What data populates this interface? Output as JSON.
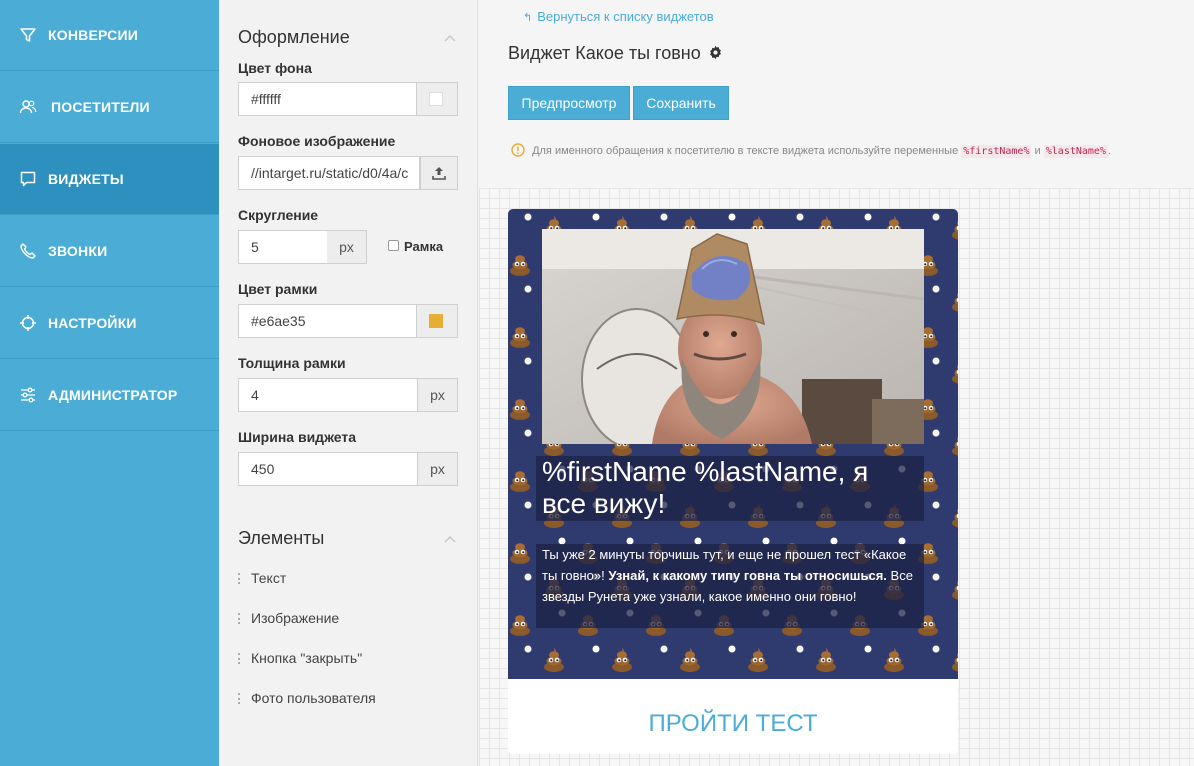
{
  "sidebar": {
    "items": [
      {
        "label": "КОНВЕРСИИ",
        "icon": "funnel-icon"
      },
      {
        "label": "ПОСЕТИТЕЛИ",
        "icon": "users-icon"
      },
      {
        "label": "ВИДЖЕТЫ",
        "icon": "chat-bubble-icon",
        "active": true
      },
      {
        "label": "ЗВОНКИ",
        "icon": "phone-icon"
      },
      {
        "label": "НАСТРОЙКИ",
        "icon": "crosshair-icon"
      },
      {
        "label": "АДМИНИСТРАТОР",
        "icon": "sliders-icon"
      }
    ]
  },
  "design": {
    "title": "Оформление",
    "bg_color_label": "Цвет фона",
    "bg_color_value": "#ffffff",
    "bg_image_label": "Фоновое изображение",
    "bg_image_value": "//intarget.ru/static/d0/4a/c",
    "radius_label": "Скругление",
    "radius_value": "5",
    "radius_unit": "px",
    "frame_checkbox_label": "Рамка",
    "frame_color_label": "Цвет рамки",
    "frame_color_value": "#e6ae35",
    "frame_width_label": "Толщина рамки",
    "frame_width_value": "4",
    "frame_width_unit": "px",
    "widget_width_label": "Ширина виджета",
    "widget_width_value": "450",
    "widget_width_unit": "px"
  },
  "elements": {
    "title": "Элементы",
    "items": [
      "Текст",
      "Изображение",
      "Кнопка \"закрыть\"",
      "Фото пользователя"
    ]
  },
  "main": {
    "back_link": "Вернуться к списку виджетов",
    "title": "Виджет Какое ты говно",
    "preview_button": "Предпросмотр",
    "save_button": "Сохранить",
    "hint_text": "Для именного обращения к посетителю в тексте виджета используйте переменные",
    "hint_var1": "%firstName%",
    "hint_and": "и",
    "hint_var2": "%lastName%",
    "hint_end": "."
  },
  "widget": {
    "headline": "%firstName %lastName, я все вижу!",
    "body_part1": "Ты уже 2 минуты торчишь тут, и еще не прошел тест «Какое ты говно»!",
    "body_bold": " Узнай, к какому типу говна ты относишься.",
    "body_part2": " Все звезды Рунета уже узнали, какое именно они говно!",
    "cta_label": "ПРОЙТИ ТЕСТ"
  },
  "colors": {
    "sidebar": "#4bacd6",
    "sidebar_active": "#2d90bf",
    "accent": "#4bacd6",
    "frame_swatch": "#e6ae35",
    "widget_bg": "#2f3a6e"
  }
}
